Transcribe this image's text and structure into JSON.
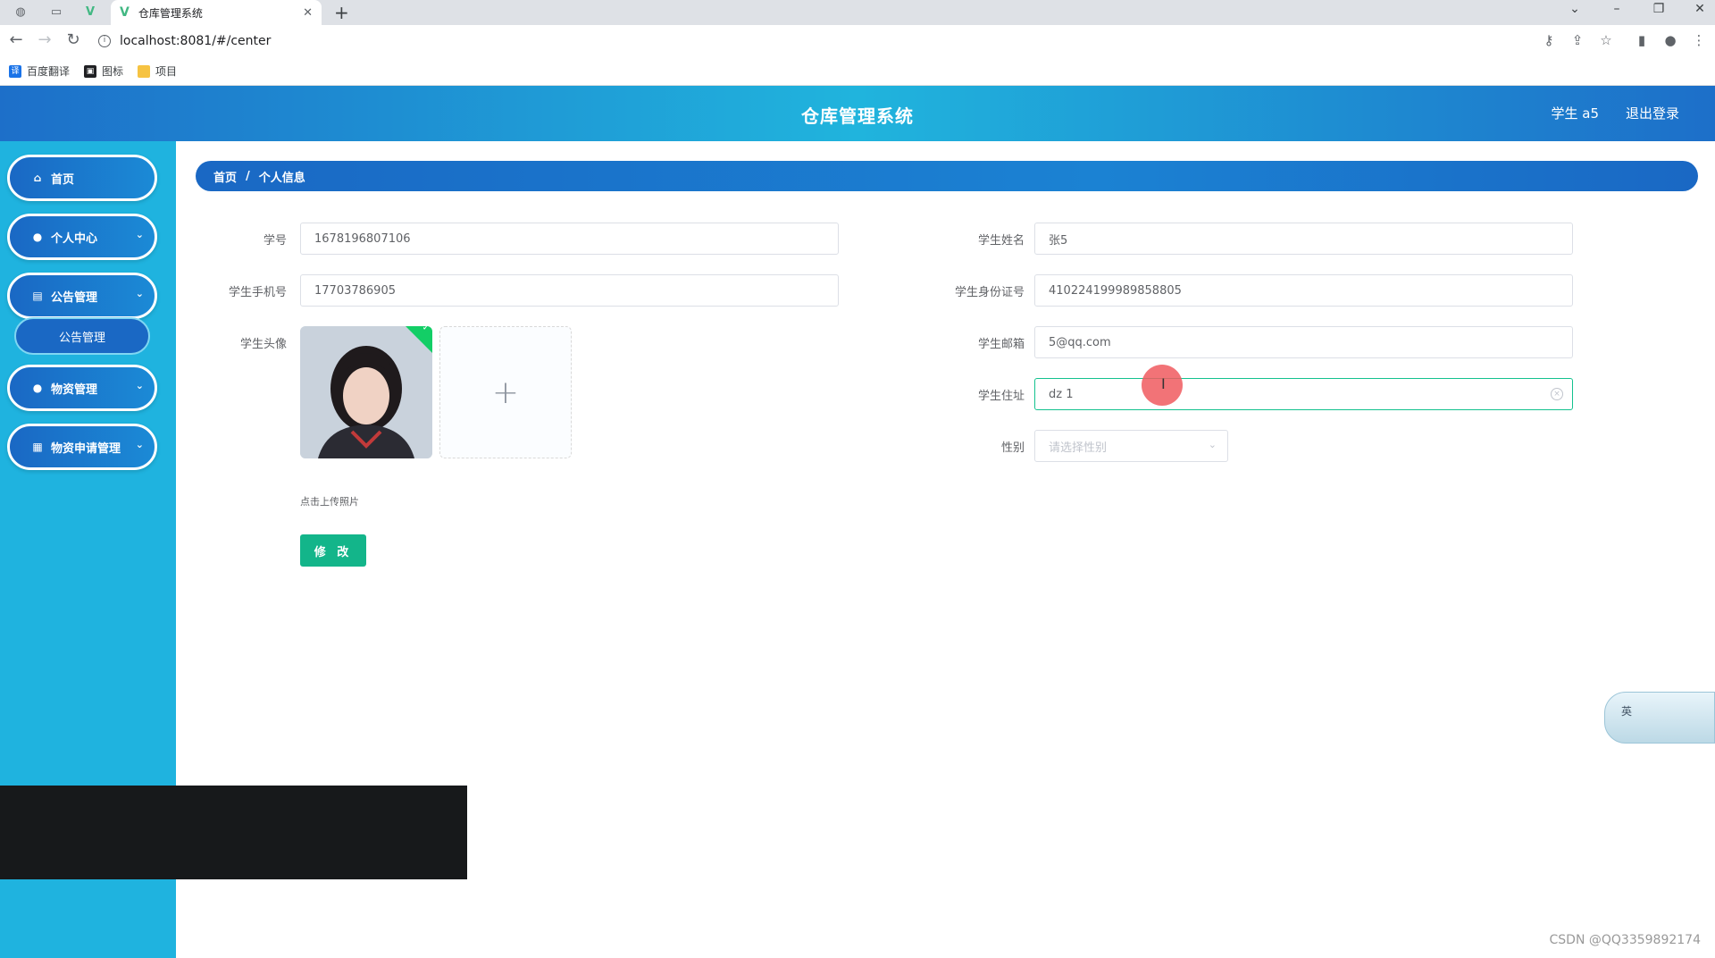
{
  "browser": {
    "tab_title": "仓库管理系统",
    "tab_close": "✕",
    "new_tab": "+",
    "url": "localhost:8081/#/center",
    "bookmarks": [
      {
        "label": "百度翻译",
        "icon": "translate-icon",
        "color": "#1a73e8"
      },
      {
        "label": "图标",
        "icon": "image-icon",
        "color": "#202124"
      },
      {
        "label": "项目",
        "icon": "folder-icon",
        "color": "#f6c342"
      }
    ]
  },
  "header": {
    "title": "仓库管理系统",
    "user": "学生 a5",
    "logout": "退出登录"
  },
  "sidebar": {
    "items": [
      {
        "label": "首页",
        "icon": "home-icon"
      },
      {
        "label": "个人中心",
        "icon": "user-icon"
      },
      {
        "label": "公告管理",
        "icon": "clipboard-icon"
      },
      {
        "label": "物资管理",
        "icon": "user-icon"
      },
      {
        "label": "物资申请管理",
        "icon": "grid-icon"
      }
    ],
    "sub_item": "公告管理"
  },
  "breadcrumb": {
    "home": "首页",
    "separator": "/",
    "current": "个人信息"
  },
  "form": {
    "student_id_label": "学号",
    "student_id": "1678196807106",
    "student_name_label": "学生姓名",
    "student_name": "张5",
    "phone_label": "学生手机号",
    "phone": "17703786905",
    "id_card_label": "学生身份证号",
    "id_card": "410224199989858805",
    "avatar_label": "学生头像",
    "email_label": "学生邮箱",
    "email": "5@qq.com",
    "address_label": "学生住址",
    "address": "dz 1",
    "gender_label": "性别",
    "gender_placeholder": "请选择性别",
    "upload_plus": "+",
    "upload_tip": "点击上传照片",
    "submit_label": "修 改"
  },
  "ime": {
    "lang": "英"
  },
  "watermark": "CSDN @QQ3359892174",
  "colors": {
    "header_blue": "#1d6fc9",
    "sidebar_cyan": "#1fb3df",
    "button_green": "#13b58a"
  }
}
